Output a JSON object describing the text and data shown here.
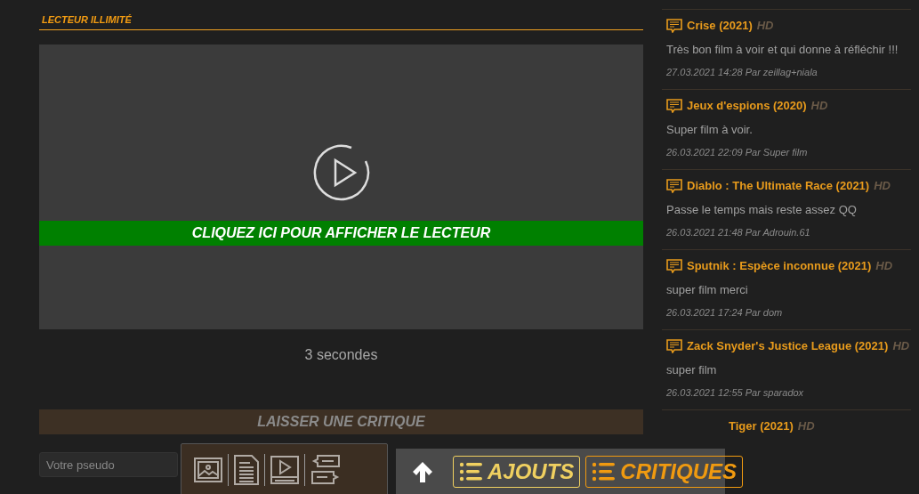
{
  "player": {
    "heading": "LECTEUR ILLIMITÉ",
    "cta": "CLIQUEZ ICI POUR AFFICHER LE LECTEUR",
    "countdown": "3 secondes"
  },
  "review_form": {
    "heading": "LAISSER UNE CRITIQUE",
    "pseudo": {
      "placeholder": "Votre pseudo"
    }
  },
  "reviews": [
    {
      "kind": "full",
      "title": "Crise (2021)",
      "badge": "HD",
      "comment": "Très bon film à voir et qui donne à réfléchir !!!",
      "meta": "27.03.2021 14:28 Par zeillag+niala"
    },
    {
      "kind": "full",
      "title": "Jeux d'espions (2020)",
      "badge": "HD",
      "comment": "Super film à voir.",
      "meta": "26.03.2021 22:09 Par Super film"
    },
    {
      "kind": "full",
      "title": "Diablo : The Ultimate Race (2021)",
      "badge": "HD",
      "comment": "Passe le temps mais reste assez QQ",
      "meta": "26.03.2021 21:48 Par Adrouin.61"
    },
    {
      "kind": "full",
      "title": "Sputnik : Espèce inconnue (2021)",
      "badge": "HD",
      "comment": "super film merci",
      "meta": "26.03.2021 17:24 Par dom"
    },
    {
      "kind": "full",
      "title": "Zack Snyder's Justice League (2021)",
      "badge": "HD",
      "comment": "super film",
      "meta": "26.03.2021 12:55 Par sparadox"
    },
    {
      "kind": "covered",
      "title": "Tiger (2021)",
      "badge": "HD"
    }
  ],
  "editor_toolbar": {
    "tools": [
      {
        "kind": "image"
      },
      {
        "kind": "document"
      },
      {
        "kind": "video"
      },
      {
        "kind": "quote"
      }
    ]
  },
  "floating_nav": {
    "links": [
      {
        "label": "AJOUTS",
        "color": "#f0d060"
      },
      {
        "label": "CRITIQUES",
        "color": "#f09a10"
      }
    ]
  }
}
